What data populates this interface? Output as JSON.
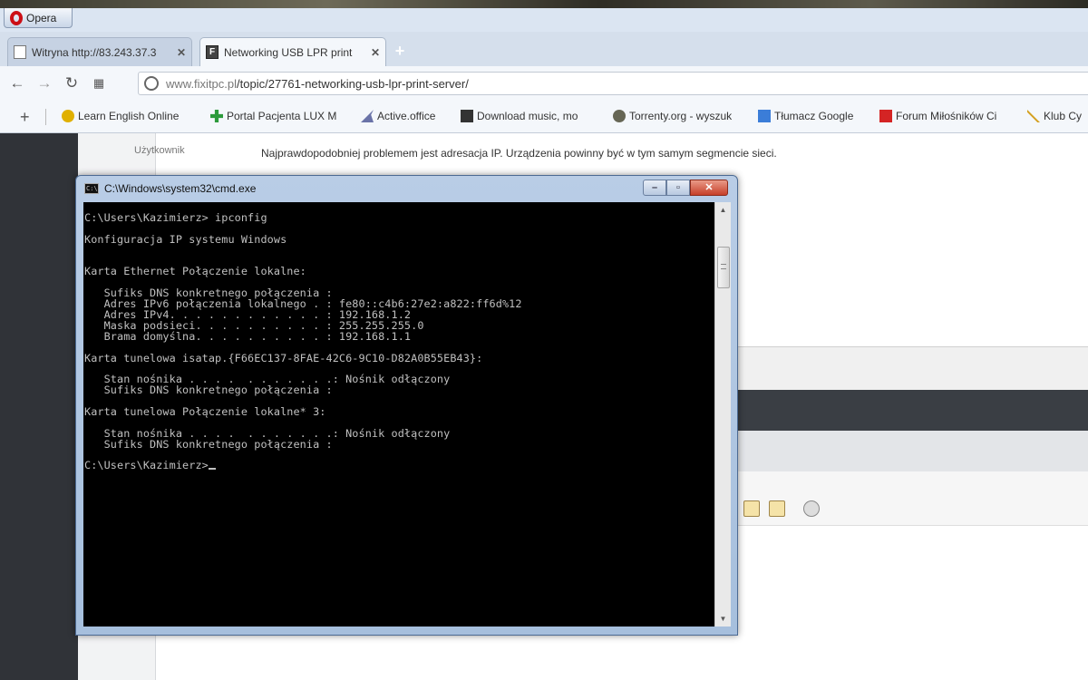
{
  "browser": {
    "menu_label": "Opera",
    "tabs": [
      {
        "title": "Witryna http://83.243.37.3",
        "close": "✕",
        "active": false
      },
      {
        "title": "Networking USB LPR print",
        "close": "✕",
        "active": true
      }
    ],
    "new_tab": "+",
    "url_host": "www.fixitpc.pl",
    "url_path": "/topic/27761-networking-usb-lpr-print-server/",
    "bookmarks_add": "+",
    "bookmarks": [
      {
        "label": "Learn English Online",
        "color": "#e0b000"
      },
      {
        "label": "Portal Pacjenta LUX M",
        "color": "#2c9a3b"
      },
      {
        "label": "Active.office",
        "color": "#6a73a8"
      },
      {
        "label": "Download music, mo",
        "color": "#333333"
      },
      {
        "label": "Torrenty.org - wyszuk",
        "color": "#666655"
      },
      {
        "label": "Tłumacz Google",
        "color": "#3b7dd8"
      },
      {
        "label": "Forum Miłośników Ci",
        "color": "#d42424"
      },
      {
        "label": "Klub Cy",
        "color": "#d4a020"
      }
    ]
  },
  "page": {
    "user_label": "Użytkownik",
    "post_text": "Najprawdopodobniej problemem jest adresacja IP. Urządzenia powinny być w tym samym segmencie sieci."
  },
  "cmd": {
    "title": "C:\\Windows\\system32\\cmd.exe",
    "lines": [
      "C:\\Users\\Kazimierz> ipconfig",
      "",
      "Konfiguracja IP systemu Windows",
      "",
      "",
      "Karta Ethernet Połączenie lokalne:",
      "",
      "   Sufiks DNS konkretnego połączenia :",
      "   Adres IPv6 połączenia lokalnego . : fe80::c4b6:27e2:a822:ff6d%12",
      "   Adres IPv4. . . . . . . . . . . . : 192.168.1.2",
      "   Maska podsieci. . . . . . . . . . : 255.255.255.0",
      "   Brama domyślna. . . . . . . . . . : 192.168.1.1",
      "",
      "Karta tunelowa isatap.{F66EC137-8FAE-42C6-9C10-D82A0B55EB43}:",
      "",
      "   Stan nośnika . . . .  . . . . . . .: Nośnik odłączony",
      "   Sufiks DNS konkretnego połączenia :",
      "",
      "Karta tunelowa Połączenie lokalne* 3:",
      "",
      "   Stan nośnika . . . .  . . . . . . .: Nośnik odłączony",
      "   Sufiks DNS konkretnego połączenia :",
      "",
      "C:\\Users\\Kazimierz>"
    ]
  }
}
